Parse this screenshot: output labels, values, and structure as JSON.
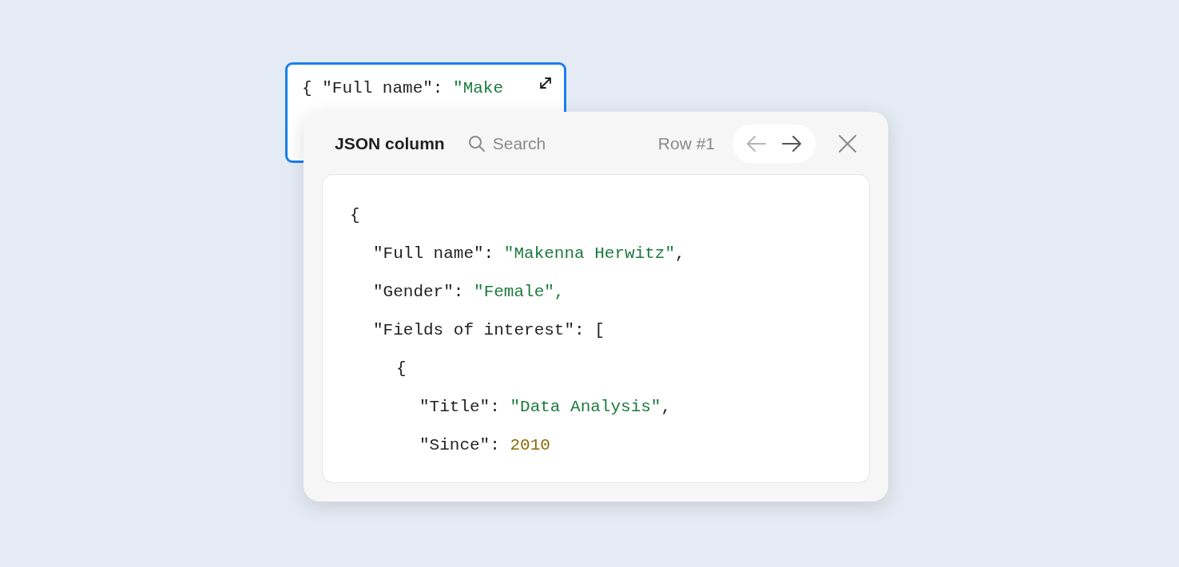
{
  "cell": {
    "tokens": [
      {
        "kind": "punct",
        "text": "{ "
      },
      {
        "kind": "key",
        "text": "\"Full name\": "
      },
      {
        "kind": "string",
        "text": "\"Make"
      }
    ],
    "focused": true
  },
  "popup": {
    "title": "JSON column",
    "search": {
      "placeholder": "Search"
    },
    "row_label": "Row #1",
    "nav": [
      {
        "kind": "prev",
        "disabled": true
      },
      {
        "kind": "next",
        "disabled": false
      }
    ],
    "lines": [
      {
        "tokens": [
          {
            "kind": "punct",
            "text": "{"
          }
        ],
        "children": [
          {
            "tokens": [
              {
                "kind": "key",
                "text": "\"Full name\": "
              },
              {
                "kind": "string",
                "text": "\"Makenna Herwitz\""
              },
              {
                "kind": "punct",
                "text": ","
              }
            ]
          },
          {
            "tokens": [
              {
                "kind": "key",
                "text": "\"Gender\": "
              },
              {
                "kind": "string",
                "text": "\"Female\","
              }
            ]
          },
          {
            "tokens": [
              {
                "kind": "key",
                "text": "\"Fields of interest\": "
              },
              {
                "kind": "punct",
                "text": "["
              }
            ],
            "children": [
              {
                "tokens": [
                  {
                    "kind": "punct",
                    "text": "{"
                  }
                ],
                "children": [
                  {
                    "tokens": [
                      {
                        "kind": "key",
                        "text": "\"Title\": "
                      },
                      {
                        "kind": "string",
                        "text": "\"Data Analysis\""
                      },
                      {
                        "kind": "punct",
                        "text": ","
                      }
                    ]
                  },
                  {
                    "tokens": [
                      {
                        "kind": "key",
                        "text": "\"Since\": "
                      },
                      {
                        "kind": "number",
                        "text": "2010"
                      }
                    ]
                  }
                ]
              }
            ]
          }
        ]
      }
    ]
  }
}
